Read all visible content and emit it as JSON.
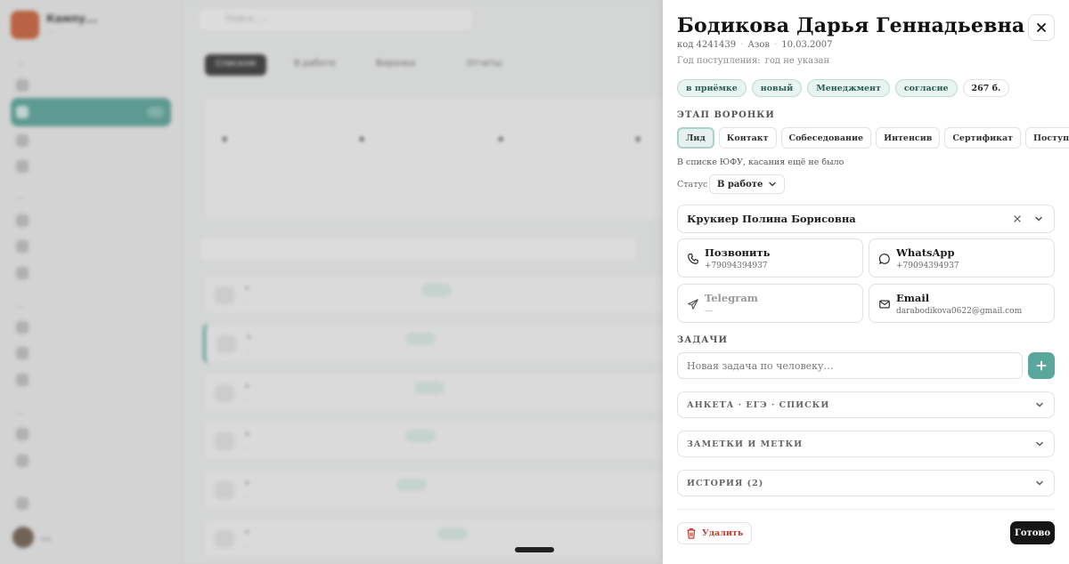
{
  "background": {
    "brand": "Кампу...",
    "brand_sub": "...",
    "search_placeholder": "Поиск, ...",
    "user_name": "...",
    "tabs": [
      "Списком",
      "В работе",
      "Воронка",
      "Отчеты"
    ]
  },
  "drawer": {
    "title": "Бодикова Дарья Геннадьевна",
    "meta": {
      "code": "код 4241439",
      "city": "Азов",
      "birth": "10.03.2007"
    },
    "year": {
      "label": "Год поступления:",
      "value": "год не указан"
    },
    "badges": [
      "в приёмке",
      "новый",
      "Менеджмент",
      "согласие",
      "267 б."
    ],
    "funnel": {
      "label": "ЭТАП ВОРОНКИ",
      "stages": [
        "Лид",
        "Контакт",
        "Собеседование",
        "Интенсив",
        "Сертификат",
        "Поступил"
      ],
      "active_stage": "Лид",
      "note": "В списке ЮФУ, касания ещё не было"
    },
    "status": {
      "label": "Статус",
      "value": "В работе"
    },
    "assignee": "Крукиер Полина Борисовна",
    "contacts": [
      {
        "label": "Позвонить",
        "value": "+79094394937",
        "icon": "phone-icon"
      },
      {
        "label": "WhatsApp",
        "value": "+79094394937",
        "icon": "whatsapp-icon"
      },
      {
        "label": "Telegram",
        "value": "—",
        "icon": "telegram-icon"
      },
      {
        "label": "Email",
        "value": "darabodikova0622@gmail.com",
        "icon": "mail-icon"
      }
    ],
    "tasks": {
      "label": "ЗАДАЧИ",
      "placeholder": "Новая задача по человеку…"
    },
    "sections": [
      "АНКЕТА · ЕГЭ · СПИСКИ",
      "ЗАМЕТКИ И МЕТКИ",
      "ИСТОРИЯ (2)"
    ],
    "delete_label": "Удалить",
    "done_label": "Готово"
  }
}
